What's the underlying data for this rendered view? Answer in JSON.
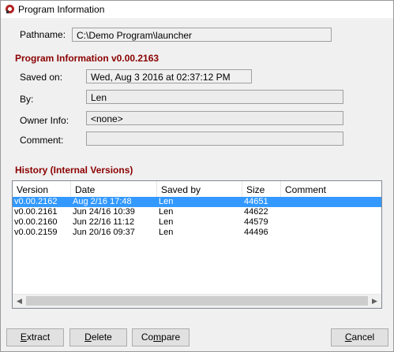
{
  "window": {
    "title": "Program Information"
  },
  "pathname": {
    "label": "Pathname:",
    "value": "C:\\Demo Program\\launcher"
  },
  "program_info": {
    "heading": "Program Information v0.00.2163",
    "saved_on_label": "Saved on:",
    "saved_on_value": "Wed, Aug 3 2016 at 02:37:12 PM",
    "by_label": "By:",
    "by_value": "Len",
    "owner_label": "Owner Info:",
    "owner_value": "<none>",
    "comment_label": "Comment:",
    "comment_value": ""
  },
  "history": {
    "heading": "History (Internal Versions)",
    "columns": [
      "Version",
      "Date",
      "Saved by",
      "Size",
      "Comment"
    ],
    "rows": [
      {
        "version": "v0.00.2162",
        "date": "Aug 2/16 17:48",
        "saved_by": "Len",
        "size": "44651",
        "comment": "",
        "selected": true
      },
      {
        "version": "v0.00.2161",
        "date": "Jun 24/16 10:39",
        "saved_by": "Len",
        "size": "44622",
        "comment": "",
        "selected": false
      },
      {
        "version": "v0.00.2160",
        "date": "Jun 22/16 11:12",
        "saved_by": "Len",
        "size": "44579",
        "comment": "",
        "selected": false
      },
      {
        "version": "v0.00.2159",
        "date": "Jun 20/16 09:37",
        "saved_by": "Len",
        "size": "44496",
        "comment": "",
        "selected": false
      }
    ]
  },
  "buttons": {
    "extract": {
      "mnemonic": "E",
      "rest": "xtract"
    },
    "delete": {
      "mnemonic": "D",
      "rest": "elete"
    },
    "compare": {
      "pre": "Co",
      "mnemonic": "m",
      "rest": "pare"
    },
    "cancel": {
      "mnemonic": "C",
      "rest": "ancel"
    }
  },
  "icons": {
    "app": "program-info-icon",
    "scroll_left": "scroll-left-icon",
    "scroll_right": "scroll-right-icon"
  },
  "colors": {
    "heading": "#8b0000",
    "selection": "#3399ff"
  }
}
